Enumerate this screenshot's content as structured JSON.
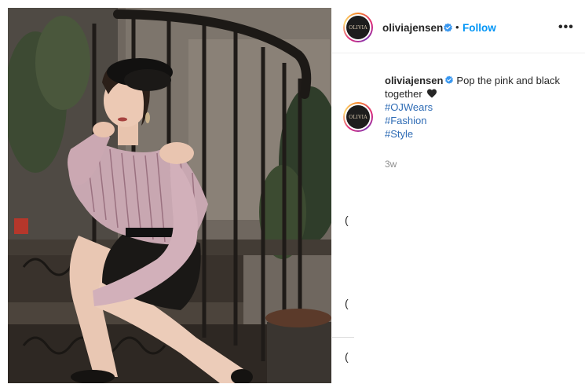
{
  "post": {
    "username": "oliviajensen",
    "follow_label": "Follow",
    "separator": "•",
    "more_label": "•••",
    "avatar_logo_text": "OLIVIA",
    "caption": {
      "username": "oliviajensen",
      "text": "Pop the pink and black together",
      "hashtags": [
        "#OJWears",
        "#Fashion",
        "#Style"
      ]
    },
    "timestamp": "3w"
  },
  "colors": {
    "accent": "#0095f6",
    "hashtag": "#2f6cb5",
    "text": "#262626",
    "muted": "#8e8e8e"
  },
  "icons": [
    "verified-badge-icon",
    "black-heart-icon",
    "more-options-icon"
  ]
}
